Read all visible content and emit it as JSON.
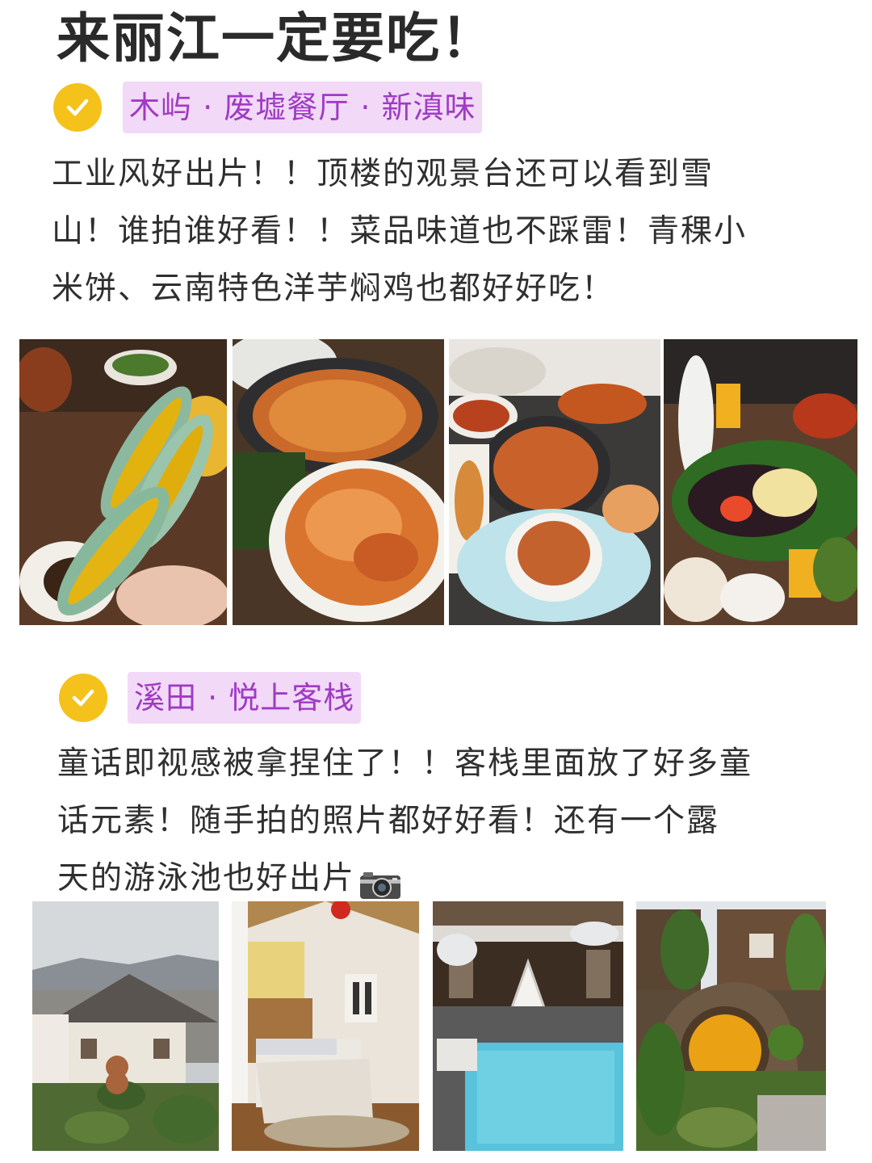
{
  "page": {
    "title": "来丽江一定要吃！"
  },
  "sections": [
    {
      "tag": "木屿 · 废墟餐厅 · 新滇味",
      "lines": [
        "工业风好出片！！顶楼的观景台还可以看到雪",
        "山！谁拍谁好看！！菜品味道也不踩雷！青稞小",
        "米饼、云南特色洋芋焖鸡也都好好吃！"
      ],
      "photos": [
        "green-flatbread-with-yellow-filling",
        "potato-braised-chicken-in-wok",
        "table-of-dishes-with-bowl",
        "banquet-platter-with-drinks"
      ]
    },
    {
      "tag": "溪田 · 悦上客栈",
      "lines": [
        "童话即视感被拿捏住了！！客栈里面放了好多童",
        "话元素！随手拍的照片都好好看！还有一个露",
        "天的游泳池也好出片"
      ],
      "photos": [
        "inn-garden-with-bear-statue",
        "wooden-bedroom-interior",
        "courtyard-swimming-pool",
        "round-yellow-hobbit-door"
      ]
    }
  ],
  "colors": {
    "check_badge": "#f4c21a",
    "tag_background": "#f1d9f7",
    "tag_text": "#a03ac4"
  },
  "icons": [
    "check-icon",
    "camera-icon"
  ]
}
